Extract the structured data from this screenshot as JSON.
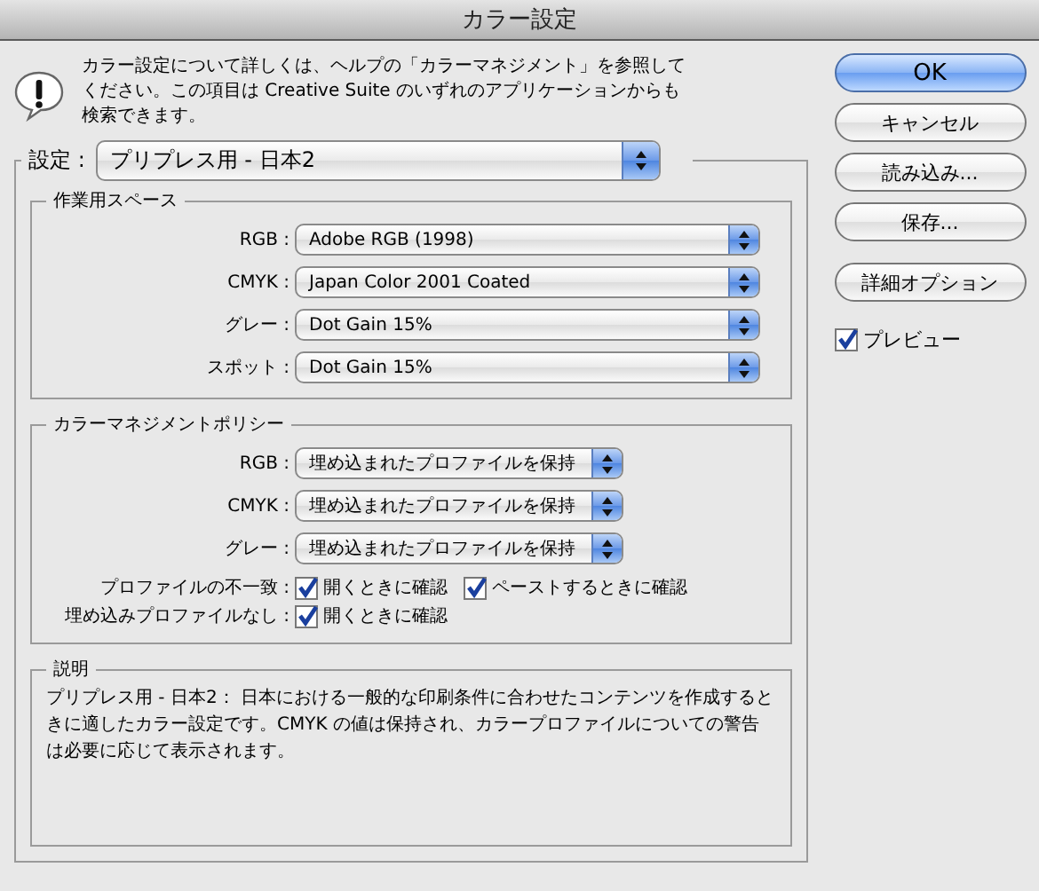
{
  "window": {
    "title": "カラー設定"
  },
  "message": "カラー設定について詳しくは、ヘルプの「カラーマネジメント」を参照してください。この項目は Creative Suite のいずれのアプリケーションからも検索できます。",
  "settings": {
    "label": "設定 :",
    "value": "プリプレス用 - 日本2"
  },
  "working_spaces": {
    "title": "作業用スペース",
    "rows": [
      {
        "label": "RGB :",
        "value": "Adobe RGB (1998)"
      },
      {
        "label": "CMYK :",
        "value": "Japan Color 2001 Coated"
      },
      {
        "label": "グレー :",
        "value": "Dot Gain 15%"
      },
      {
        "label": "スポット :",
        "value": "Dot Gain 15%"
      }
    ]
  },
  "policies": {
    "title": "カラーマネジメントポリシー",
    "rows": [
      {
        "label": "RGB :",
        "value": "埋め込まれたプロファイルを保持"
      },
      {
        "label": "CMYK :",
        "value": "埋め込まれたプロファイルを保持"
      },
      {
        "label": "グレー :",
        "value": "埋め込まれたプロファイルを保持"
      }
    ],
    "checks": [
      {
        "label": "プロファイルの不一致 :",
        "options": [
          {
            "label": "開くときに確認",
            "checked": true
          },
          {
            "label": "ペーストするときに確認",
            "checked": true
          }
        ]
      },
      {
        "label": "埋め込みプロファイルなし :",
        "options": [
          {
            "label": "開くときに確認",
            "checked": true
          }
        ]
      }
    ]
  },
  "description": {
    "title": "説明",
    "text": "プリプレス用 - 日本2： 日本における一般的な印刷条件に合わせたコンテンツを作成するときに適したカラー設定です。CMYK の値は保持され、カラープロファイルについての警告は必要に応じて表示されます。"
  },
  "buttons": [
    {
      "label": "OK",
      "default": true
    },
    {
      "label": "キャンセル",
      "default": false
    },
    {
      "label": "読み込み...",
      "default": false
    },
    {
      "label": "保存...",
      "default": false
    },
    {
      "label": "詳細オプション",
      "default": false
    }
  ],
  "preview": {
    "label": "プレビュー",
    "checked": true
  }
}
